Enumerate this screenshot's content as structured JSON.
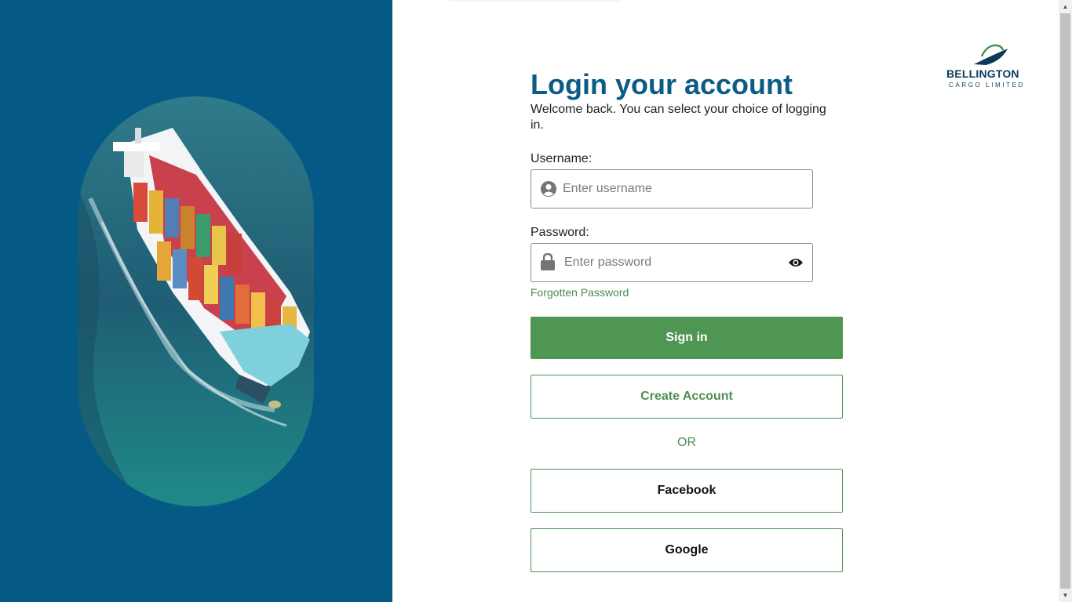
{
  "login": {
    "title": "Login your account",
    "subtitle": "Welcome back. You can select your choice of logging in.",
    "username_label": "Username:",
    "username_placeholder": "Enter username",
    "password_label": "Password:",
    "password_placeholder": "Enter password",
    "forgot_link": "Forgotten Password",
    "sign_in": "Sign in",
    "create_account": "Create Account",
    "or": "OR",
    "facebook": "Facebook",
    "google": "Google"
  },
  "brand": {
    "name": "BELLINGTON",
    "tagline": "CARGO LIMITED"
  },
  "icons": {
    "username": "user-circle-icon",
    "password": "lock-icon",
    "visibility": "eye-icon"
  },
  "colors": {
    "panel": "#045a85",
    "title": "#0b5b86",
    "primary": "#509653",
    "outline": "#4e8f52"
  }
}
